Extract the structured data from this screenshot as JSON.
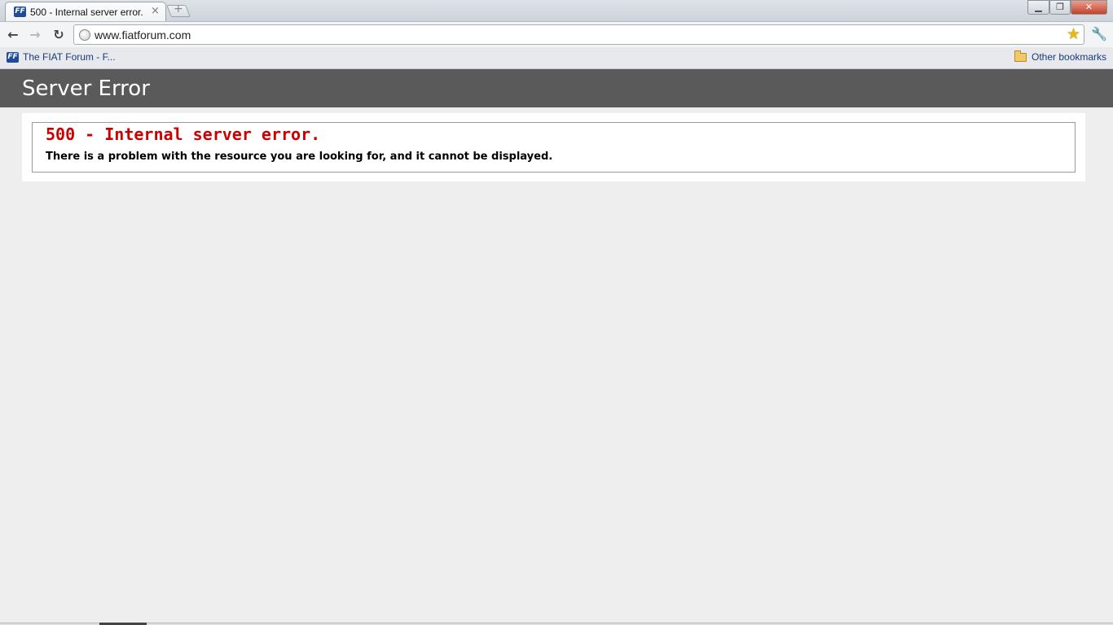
{
  "browser": {
    "tab": {
      "favicon_text": "FF",
      "title": "500 - Internal server error.",
      "close_glyph": "×"
    },
    "new_tab_glyph": "+",
    "window_controls": {
      "minimize": "▁",
      "maximize": "❐",
      "close": "✕"
    },
    "toolbar": {
      "back_glyph": "←",
      "forward_glyph": "→",
      "reload_glyph": "↻",
      "url": "www.fiatforum.com",
      "star_glyph": "★",
      "wrench_glyph": "🔧"
    },
    "bookmarks": {
      "items": [
        {
          "favicon_text": "FF",
          "label": "The FIAT Forum - F..."
        }
      ],
      "other_label": "Other bookmarks"
    }
  },
  "page": {
    "header_title": "Server Error",
    "error_heading": "500 - Internal server error.",
    "error_message": "There is a problem with the resource you are looking for, and it cannot be displayed."
  },
  "colors": {
    "header_bg": "#5a5a5a",
    "error_red": "#cc0000",
    "page_bg": "#eeeeee"
  }
}
